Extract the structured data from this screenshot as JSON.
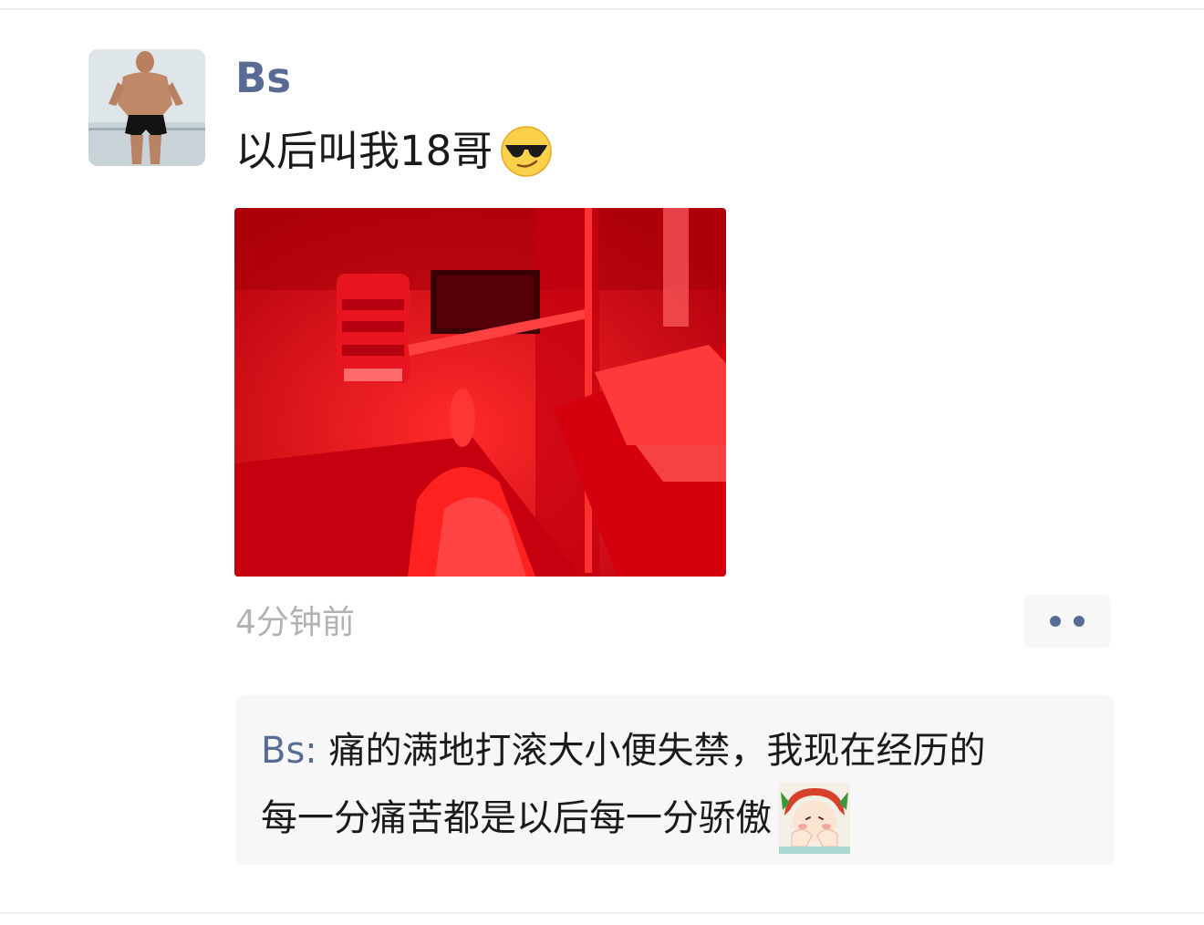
{
  "post": {
    "author": "Bs",
    "text": "以后叫我18哥",
    "emoji": "sunglasses-emoji",
    "time": "4分钟前"
  },
  "comment": {
    "author": "Bs",
    "separator": ": ",
    "line1": "痛的满地打滚大小便失禁，我现在经历的",
    "line2": "每一分痛苦都是以后每一分骄傲",
    "sticker": "cute-girl-sticker"
  },
  "colors": {
    "name": "#576b95",
    "timestamp": "#b2b2b2",
    "comment_bg": "#f7f7f7",
    "photo_red": "#e00010"
  }
}
